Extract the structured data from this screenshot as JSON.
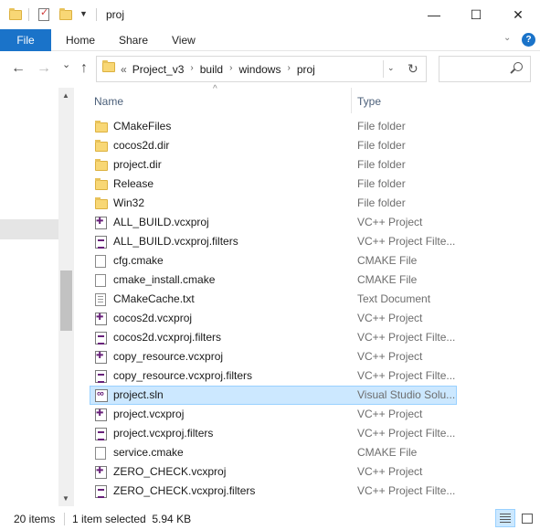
{
  "window": {
    "title": "proj",
    "controls": {
      "minimize": "—",
      "maximize": "☐",
      "close": "✕"
    }
  },
  "ribbon": {
    "tabs": [
      "File",
      "Home",
      "Share",
      "View"
    ],
    "help": "?"
  },
  "nav": {
    "back_icon": "←",
    "forward_icon": "→",
    "recent_icon": "⌄",
    "up_icon": "↑",
    "overflow": "«",
    "breadcrumbs": [
      "Project_v3",
      "build",
      "windows",
      "proj"
    ],
    "refresh_icon": "↻"
  },
  "columns": {
    "name": "Name",
    "type": "Type",
    "sort_indicator": "^"
  },
  "files": [
    {
      "name": "CMakeFiles",
      "type": "File folder",
      "icon": "folder"
    },
    {
      "name": "cocos2d.dir",
      "type": "File folder",
      "icon": "folder"
    },
    {
      "name": "project.dir",
      "type": "File folder",
      "icon": "folder"
    },
    {
      "name": "Release",
      "type": "File folder",
      "icon": "folder"
    },
    {
      "name": "Win32",
      "type": "File folder",
      "icon": "folder"
    },
    {
      "name": "ALL_BUILD.vcxproj",
      "type": "VC++ Project",
      "icon": "vcxproj"
    },
    {
      "name": "ALL_BUILD.vcxproj.filters",
      "type": "VC++ Project Filte...",
      "icon": "filters"
    },
    {
      "name": "cfg.cmake",
      "type": "CMAKE File",
      "icon": "doc"
    },
    {
      "name": "cmake_install.cmake",
      "type": "CMAKE File",
      "icon": "doc"
    },
    {
      "name": "CMakeCache.txt",
      "type": "Text Document",
      "icon": "txt"
    },
    {
      "name": "cocos2d.vcxproj",
      "type": "VC++ Project",
      "icon": "vcxproj"
    },
    {
      "name": "cocos2d.vcxproj.filters",
      "type": "VC++ Project Filte...",
      "icon": "filters"
    },
    {
      "name": "copy_resource.vcxproj",
      "type": "VC++ Project",
      "icon": "vcxproj"
    },
    {
      "name": "copy_resource.vcxproj.filters",
      "type": "VC++ Project Filte...",
      "icon": "filters"
    },
    {
      "name": "project.sln",
      "type": "Visual Studio Solu...",
      "icon": "sln",
      "selected": true
    },
    {
      "name": "project.vcxproj",
      "type": "VC++ Project",
      "icon": "vcxproj"
    },
    {
      "name": "project.vcxproj.filters",
      "type": "VC++ Project Filte...",
      "icon": "filters"
    },
    {
      "name": "service.cmake",
      "type": "CMAKE File",
      "icon": "doc"
    },
    {
      "name": "ZERO_CHECK.vcxproj",
      "type": "VC++ Project",
      "icon": "vcxproj"
    },
    {
      "name": "ZERO_CHECK.vcxproj.filters",
      "type": "VC++ Project Filte...",
      "icon": "filters"
    }
  ],
  "status": {
    "count": "20 items",
    "selection": "1 item selected  5.94 KB"
  },
  "colors": {
    "accent": "#1a73c9",
    "selection": "#cce8ff",
    "folder": "#f8d775"
  }
}
